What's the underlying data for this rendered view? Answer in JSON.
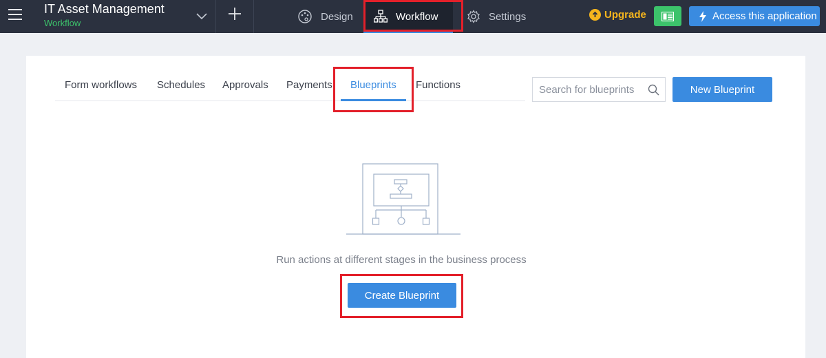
{
  "header": {
    "app_title": "IT Asset Management",
    "app_subtitle": "Workflow",
    "nav": {
      "design": "Design",
      "workflow": "Workflow",
      "settings": "Settings"
    },
    "upgrade": "Upgrade",
    "access": "Access this application"
  },
  "tabs": {
    "form_workflows": "Form workflows",
    "schedules": "Schedules",
    "approvals": "Approvals",
    "payments": "Payments",
    "blueprints": "Blueprints",
    "functions": "Functions",
    "active": "Blueprints"
  },
  "search": {
    "placeholder": "Search for blueprints"
  },
  "new_blueprint": "New Blueprint",
  "empty_state": {
    "message": "Run actions at different stages in the business process",
    "button": "Create Blueprint"
  },
  "icons": {
    "menu": "hamburger-menu-icon",
    "chevron": "chevron-down-icon",
    "add": "plus-icon",
    "design": "palette-icon",
    "workflow": "workflow-hierarchy-icon",
    "settings": "gear-icon",
    "upgrade": "arrow-up-circle-icon",
    "view": "layout-view-icon",
    "access": "lightning-icon",
    "search": "search-icon",
    "illustration": "blueprint-diagram-illustration"
  },
  "colors": {
    "topbar": "#2b313f",
    "accent": "#3a8be0",
    "green": "#3cc36b",
    "upgrade": "#f5b51d",
    "highlight": "#e3202a"
  }
}
